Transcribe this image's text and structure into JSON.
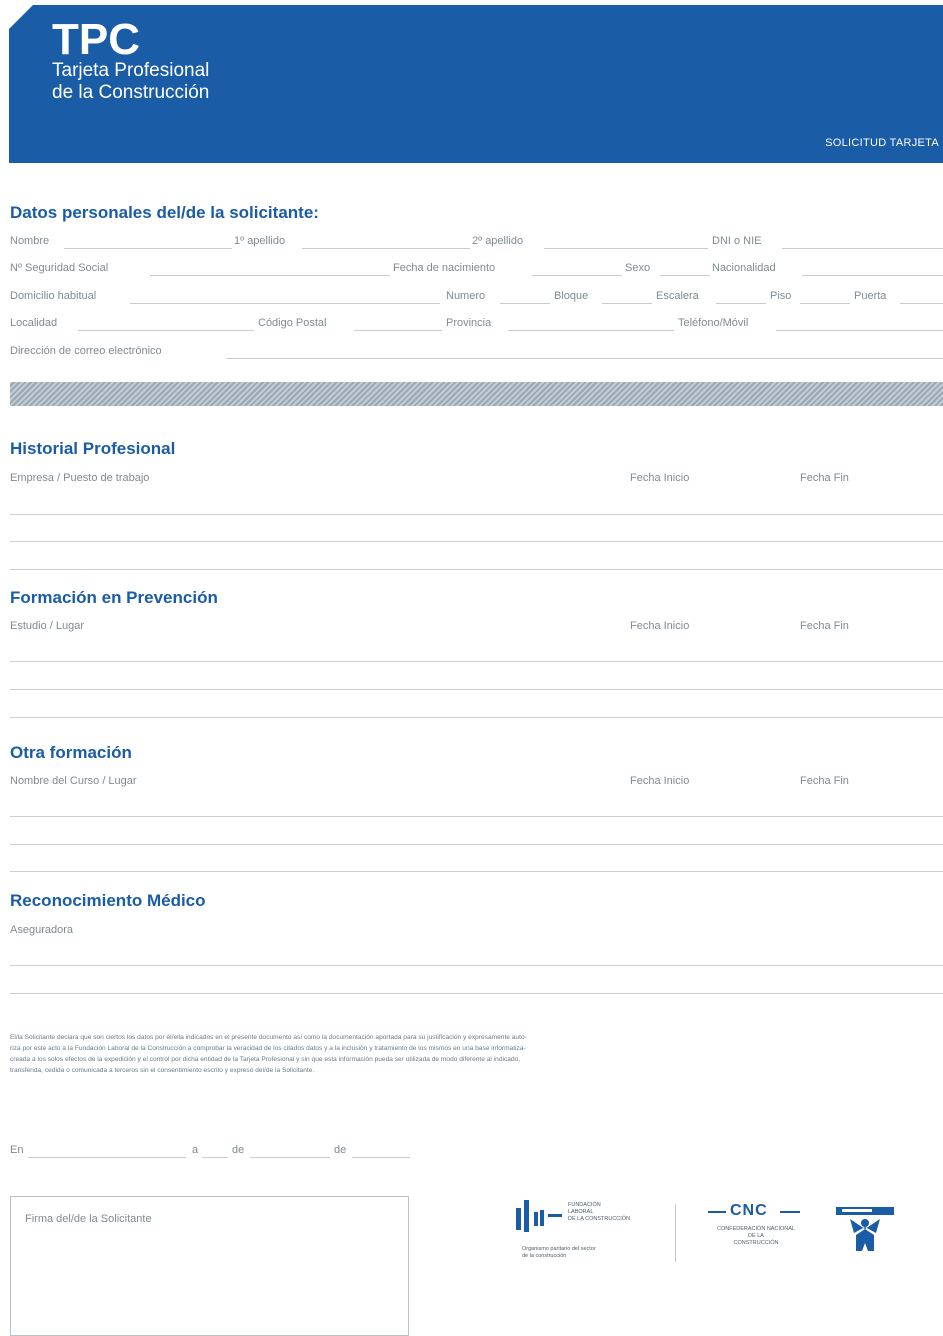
{
  "header": {
    "logo": "TPC",
    "subtitle_line1": "Tarjeta Profesional",
    "subtitle_line2": "de la Construcción",
    "doc_tag": "SOLICITUD TARJETA"
  },
  "personal": {
    "title": "Datos personales del/de la solicitante:",
    "nombre": "Nombre",
    "apellido1": "1º apellido",
    "apellido2": "2º apellido",
    "dni": "DNI o NIE",
    "seguridad_social": "Nº Seguridad Social",
    "fecha_nacimiento": "Fecha de nacimiento",
    "sexo": "Sexo",
    "nacionalidad": "Nacionalidad",
    "domicilio": "Domicilio habitual",
    "numero": "Numero",
    "bloque": "Bloque",
    "escalera": "Escalera",
    "piso": "Piso",
    "puerta": "Puerta",
    "localidad": "Localidad",
    "codigo_postal": "Código Postal",
    "provincia": "Provincia",
    "telefono": "Teléfono/Móvil",
    "email": "Dirección de correo electrónico"
  },
  "historial": {
    "title": "Historial Profesional",
    "col1": "Empresa / Puesto de trabajo",
    "col2": "Fecha Inicio",
    "col3": "Fecha Fin"
  },
  "formacion": {
    "title": "Formación en Prevención",
    "col1": "Estudio / Lugar",
    "col2": "Fecha Inicio",
    "col3": "Fecha Fin"
  },
  "otra": {
    "title": "Otra formación",
    "col1": "Nombre del Curso / Lugar",
    "col2": "Fecha Inicio",
    "col3": "Fecha Fin"
  },
  "medico": {
    "title": "Reconocimiento Médico",
    "col1": "Aseguradora"
  },
  "legal": {
    "line1": "El/la Solicitante declara que son ciertos los datos por él/ella indicados en el presente documento así como la documentación aportada para su justificación y expresamente auto-",
    "line2": "riza por este acto a la Fundación Laboral de la Construcción a comprobar la veracidad de los citados datos y a la inclusión y tratamiento de los mismos en una base informatiza-",
    "line3": "creada a los solos efectos de la expedición y el control por dicha entidad de la Tarjeta Profesional y sin que esta información pueda ser utilizada de modo diferente al indicado,",
    "line4": "transferida, cedida o comunicada a terceros sin el consentimiento escrito y expreso del/de la Solicitante."
  },
  "place_date": {
    "en": "En",
    "a": "a",
    "de1": "de",
    "de2": "de"
  },
  "signature": {
    "label": "Firma del/de la Solicitante"
  },
  "logos": {
    "flc_line1": "FUNDACIÓN",
    "flc_line2": "LABORAL",
    "flc_line3": "DE LA CONSTRUCCIÓN",
    "flc_caption1": "Organismo paritario del sector",
    "flc_caption2": "de la construcción",
    "cnc_name": "CNC",
    "cnc_line1": "CONFEDERACIÓN NACIONAL",
    "cnc_line2": "DE LA",
    "cnc_line3": "CONSTRUCCIÓN",
    "third_logo": "third-organization-logo"
  },
  "colors": {
    "brand_blue": "#1b5ca7",
    "label_gray": "#7f8b93",
    "rule_gray": "#c6cdd2"
  }
}
